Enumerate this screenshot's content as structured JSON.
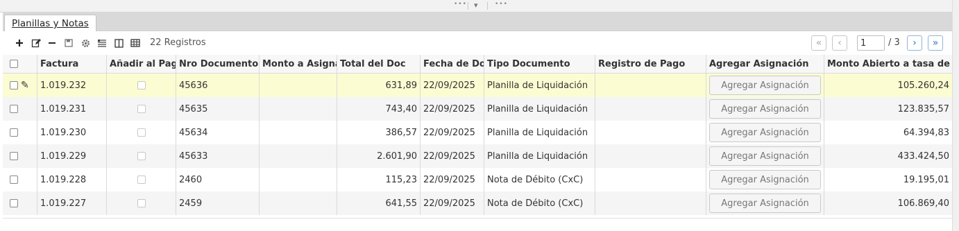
{
  "splitter": {
    "grip": "•••",
    "arrow": "▾"
  },
  "tab": {
    "label": "Planillas y Notas"
  },
  "toolbar": {
    "icons": [
      "new-icon",
      "edit-icon",
      "delete-icon",
      "save-icon",
      "settings-icon",
      "detail-view-icon",
      "split-view-icon",
      "grid-view-icon"
    ],
    "records": "22 Registros"
  },
  "pager": {
    "first": "«",
    "prev": "‹",
    "next": "›",
    "last": "»",
    "page": "1",
    "total": "/ 3"
  },
  "columns": [
    "Factura",
    "Añadir al Pago",
    "Nro Documento",
    "Monto a Asignar",
    "Total del Doc",
    "Fecha de Doc",
    "Tipo Documento",
    "Registro de Pago",
    "Agregar Asignación",
    "Monto Abierto a tasa de Doc"
  ],
  "rows": [
    {
      "factura": "1.019.232",
      "nro": "45636",
      "monto_asignar": "",
      "total": "631,89",
      "fecha": "22/09/2025",
      "tipo": "Planilla de Liquidación",
      "registro": "",
      "boton": "Agregar Asignación",
      "monto_abierto": "105.260,24"
    },
    {
      "factura": "1.019.231",
      "nro": "45635",
      "monto_asignar": "",
      "total": "743,40",
      "fecha": "22/09/2025",
      "tipo": "Planilla de Liquidación",
      "registro": "",
      "boton": "Agregar Asignación",
      "monto_abierto": "123.835,57"
    },
    {
      "factura": "1.019.230",
      "nro": "45634",
      "monto_asignar": "",
      "total": "386,57",
      "fecha": "22/09/2025",
      "tipo": "Planilla de Liquidación",
      "registro": "",
      "boton": "Agregar Asignación",
      "monto_abierto": "64.394,83"
    },
    {
      "factura": "1.019.229",
      "nro": "45633",
      "monto_asignar": "",
      "total": "2.601,90",
      "fecha": "22/09/2025",
      "tipo": "Planilla de Liquidación",
      "registro": "",
      "boton": "Agregar Asignación",
      "monto_abierto": "433.424,50"
    },
    {
      "factura": "1.019.228",
      "nro": "2460",
      "monto_asignar": "",
      "total": "115,23",
      "fecha": "22/09/2025",
      "tipo": "Nota de Débito (CxC)",
      "registro": "",
      "boton": "Agregar Asignación",
      "monto_abierto": "19.195,01"
    },
    {
      "factura": "1.019.227",
      "nro": "2459",
      "monto_asignar": "",
      "total": "641,55",
      "fecha": "22/09/2025",
      "tipo": "Nota de Débito (CxC)",
      "registro": "",
      "boton": "Agregar Asignación",
      "monto_abierto": "106.869,40"
    }
  ],
  "colors": {
    "selected_row": "#fcfcd2",
    "pager_active": "#2b79c8"
  }
}
